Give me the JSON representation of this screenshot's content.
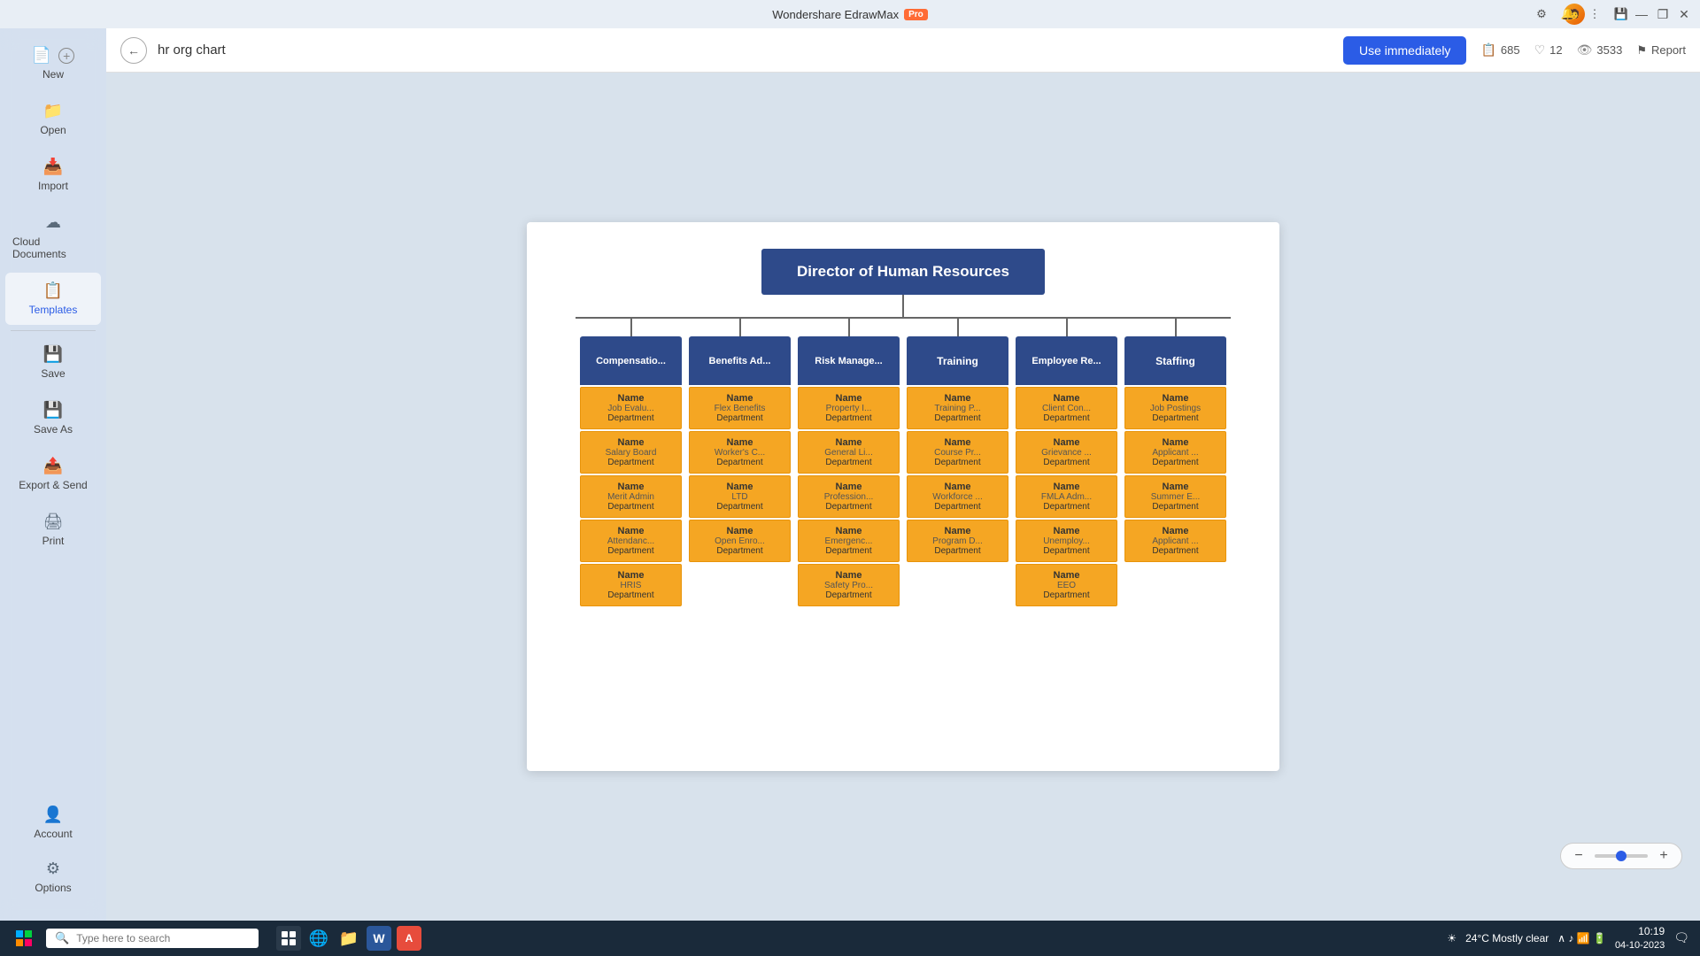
{
  "app": {
    "title": "Wondershare EdrawMax",
    "pro_badge": "Pro"
  },
  "titlebar": {
    "controls": {
      "minimize": "—",
      "restore": "❐",
      "close": "✕"
    },
    "icons": [
      "⚙",
      "🔔",
      "⋮",
      "💾"
    ]
  },
  "sidebar": {
    "items": [
      {
        "id": "new",
        "label": "New",
        "icon": "＋",
        "has_plus": true
      },
      {
        "id": "open",
        "label": "Open",
        "icon": "📁"
      },
      {
        "id": "import",
        "label": "Import",
        "icon": "📥"
      },
      {
        "id": "cloud",
        "label": "Cloud Documents",
        "icon": "☁"
      },
      {
        "id": "templates",
        "label": "Templates",
        "icon": "📋"
      },
      {
        "id": "save",
        "label": "Save",
        "icon": "💾"
      },
      {
        "id": "saveas",
        "label": "Save As",
        "icon": "💾"
      },
      {
        "id": "export",
        "label": "Export & Send",
        "icon": "📤"
      },
      {
        "id": "print",
        "label": "Print",
        "icon": "🖨"
      }
    ],
    "bottom_items": [
      {
        "id": "account",
        "label": "Account",
        "icon": "👤"
      },
      {
        "id": "options",
        "label": "Options",
        "icon": "⚙"
      }
    ]
  },
  "toolbar": {
    "search_query": "hr org chart",
    "use_immediately": "Use immediately",
    "stats": {
      "copies_icon": "📋",
      "copies": "685",
      "likes_icon": "♡",
      "likes": "12",
      "views_icon": "👁",
      "views": "3533"
    },
    "report_label": "Report",
    "report_icon": "⚑"
  },
  "diagram": {
    "root": "Director of Human Resources",
    "departments": [
      {
        "id": "compensation",
        "header": "Compensatio...",
        "cards": [
          {
            "name": "Name",
            "sub": "Job Evalu...",
            "dept": "Department"
          },
          {
            "name": "Name",
            "sub": "Salary Board",
            "dept": "Department"
          },
          {
            "name": "Name",
            "sub": "Merit Admin",
            "dept": "Department"
          },
          {
            "name": "Name",
            "sub": "Attendanc...",
            "dept": "Department"
          },
          {
            "name": "Name",
            "sub": "HRIS",
            "dept": "Department"
          }
        ]
      },
      {
        "id": "benefits",
        "header": "Benefits Ad...",
        "cards": [
          {
            "name": "Name",
            "sub": "Flex Benefits",
            "dept": "Department"
          },
          {
            "name": "Name",
            "sub": "Worker's C...",
            "dept": "Department"
          },
          {
            "name": "Name",
            "sub": "LTD",
            "dept": "Department"
          },
          {
            "name": "Name",
            "sub": "Open Enro...",
            "dept": "Department"
          }
        ]
      },
      {
        "id": "risk",
        "header": "Risk Manage...",
        "cards": [
          {
            "name": "Name",
            "sub": "Property I...",
            "dept": "Department"
          },
          {
            "name": "Name",
            "sub": "General Li...",
            "dept": "Department"
          },
          {
            "name": "Name",
            "sub": "Profession...",
            "dept": "Department"
          },
          {
            "name": "Name",
            "sub": "Emergenc...",
            "dept": "Department"
          },
          {
            "name": "Name",
            "sub": "Safety Pro...",
            "dept": "Department"
          }
        ]
      },
      {
        "id": "training",
        "header": "Training",
        "cards": [
          {
            "name": "Name",
            "sub": "Training P...",
            "dept": "Department"
          },
          {
            "name": "Name",
            "sub": "Course Pr...",
            "dept": "Department"
          },
          {
            "name": "Name",
            "sub": "Workforce ...",
            "dept": "Department"
          },
          {
            "name": "Name",
            "sub": "Program D...",
            "dept": "Department"
          }
        ]
      },
      {
        "id": "employee",
        "header": "Employee Re...",
        "cards": [
          {
            "name": "Name",
            "sub": "Client Con...",
            "dept": "Department"
          },
          {
            "name": "Name",
            "sub": "Grievance ...",
            "dept": "Department"
          },
          {
            "name": "Name",
            "sub": "FMLA Adm...",
            "dept": "Department"
          },
          {
            "name": "Name",
            "sub": "Unemploy...",
            "dept": "Department"
          },
          {
            "name": "Name",
            "sub": "EEO",
            "dept": "Department"
          }
        ]
      },
      {
        "id": "staffing",
        "header": "Staffing",
        "cards": [
          {
            "name": "Name",
            "sub": "Job Postings",
            "dept": "Department"
          },
          {
            "name": "Name",
            "sub": "Applicant ...",
            "dept": "Department"
          },
          {
            "name": "Name",
            "sub": "Summer E...",
            "dept": "Department"
          },
          {
            "name": "Name",
            "sub": "Applicant ...",
            "dept": "Department"
          }
        ]
      }
    ]
  },
  "bottombar": {
    "search_placeholder": "Type here to search",
    "time": "10:19",
    "date": "04-10-2023",
    "weather": "24°C  Mostly clear",
    "apps": [
      "⊞",
      "🔍",
      "🗔",
      "🌐",
      "📁",
      "W",
      "A"
    ]
  },
  "zoom": {
    "minus": "−",
    "plus": "+"
  }
}
